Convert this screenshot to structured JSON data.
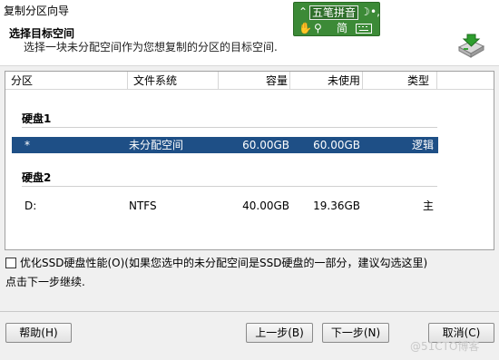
{
  "window": {
    "title": "复制分区向导"
  },
  "header": {
    "title": "选择目标空间",
    "subtitle": "选择一块未分配空间作为您想复制的分区的目标空间."
  },
  "ime": {
    "name": "五笔拼音",
    "mode": "简",
    "icons": [
      "collapse-icon",
      "moon-icon",
      "punctuation-icon",
      "hand-icon",
      "search-icon",
      "keyboard-icon"
    ]
  },
  "table": {
    "columns": [
      "分区",
      "文件系统",
      "容量",
      "未使用",
      "类型"
    ],
    "groups": [
      {
        "label": "硬盘1",
        "rows": [
          {
            "partition": "*",
            "fs": "未分配空间",
            "capacity": "60.00GB",
            "unused": "60.00GB",
            "type": "逻辑",
            "selected": true
          }
        ]
      },
      {
        "label": "硬盘2",
        "rows": [
          {
            "partition": "D:",
            "fs": "NTFS",
            "capacity": "40.00GB",
            "unused": "19.36GB",
            "type": "主",
            "selected": false
          }
        ]
      }
    ]
  },
  "option": {
    "label": "优化SSD硬盘性能(O)(如果您选中的未分配空间是SSD硬盘的一部分，建议勾选这里)",
    "checked": false
  },
  "hint": "点击下一步继续.",
  "buttons": {
    "help": "帮助(H)",
    "prev": "上一步(B)",
    "next": "下一步(N)",
    "cancel": "取消(C)"
  },
  "watermark": "@51CTO博客",
  "colors": {
    "selection": "#1e4f86",
    "ime_bg": "#3c8a37"
  }
}
